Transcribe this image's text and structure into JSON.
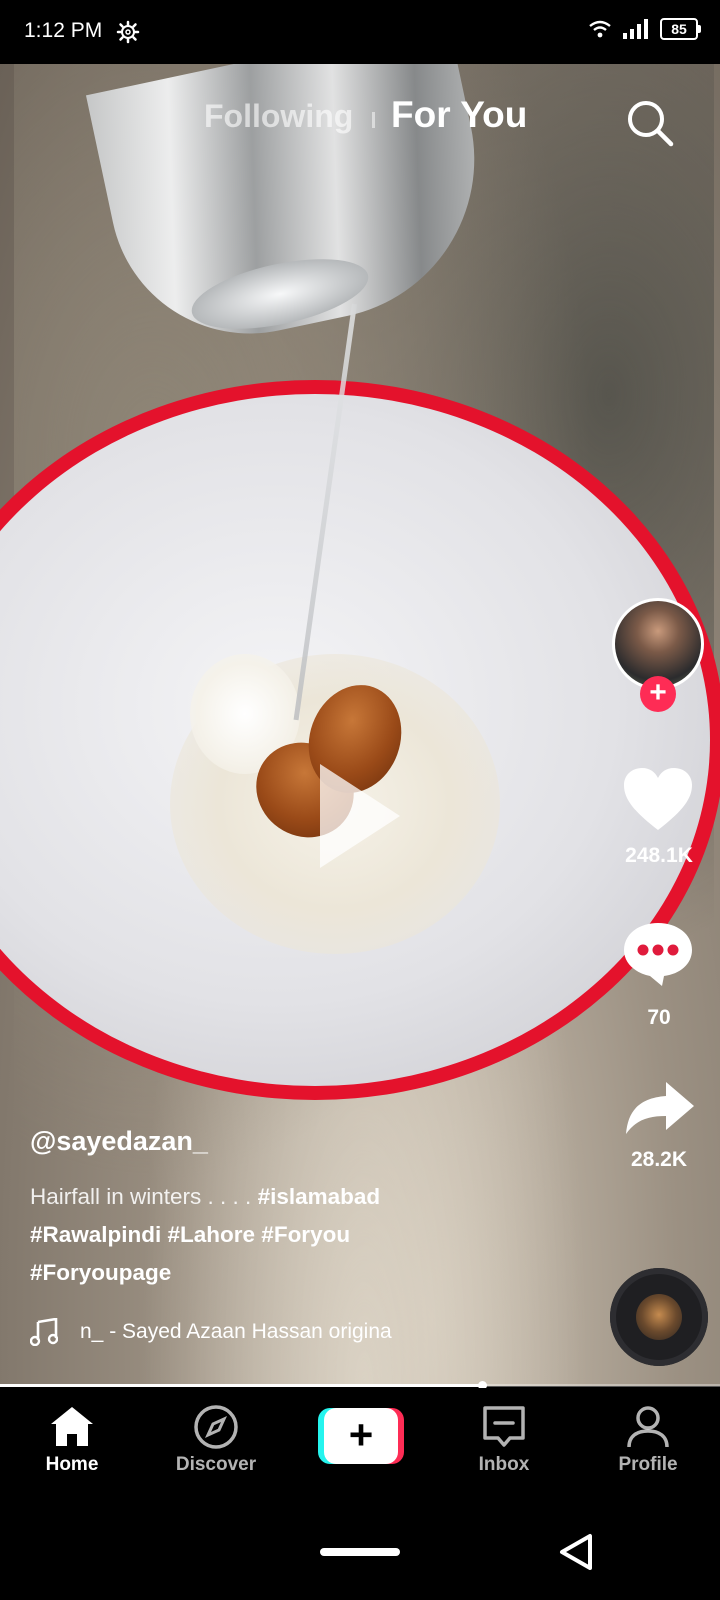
{
  "status_bar": {
    "time": "1:12 PM",
    "battery": "85"
  },
  "top_tabs": {
    "following": "Following",
    "for_you": "For You"
  },
  "post": {
    "username": "@sayedazan_",
    "caption_text": "Hairfall in winters  . . . . ",
    "caption_tags": "#islamabad #Rawalpindi #Lahore #Foryou #Foryoupage",
    "music": "n_ - Sayed Azaan Hassan    original sound"
  },
  "actions": {
    "likes": "248.1K",
    "comments": "70",
    "shares": "28.2K"
  },
  "playback_progress": 0.67,
  "bottom_nav": {
    "home": "Home",
    "discover": "Discover",
    "inbox": "Inbox",
    "profile": "Profile"
  },
  "colors": {
    "accent_red": "#fe2c55",
    "accent_cyan": "#25f4ee"
  }
}
